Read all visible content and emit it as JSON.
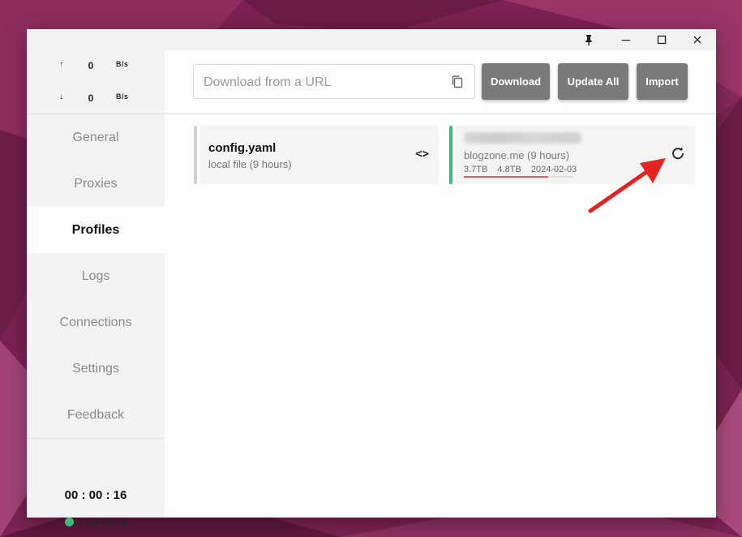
{
  "window": {
    "controls": {
      "pin_icon": "pin-icon",
      "minimize_icon": "minimize-icon",
      "maximize_icon": "maximize-icon",
      "close_icon": "close-icon"
    }
  },
  "traffic": {
    "upload": {
      "arrow": "↑",
      "value": "0",
      "unit": "B/s"
    },
    "download": {
      "arrow": "↓",
      "value": "0",
      "unit": "B/s"
    }
  },
  "sidebar": {
    "items": [
      {
        "label": "General",
        "active": false
      },
      {
        "label": "Proxies",
        "active": false
      },
      {
        "label": "Profiles",
        "active": true
      },
      {
        "label": "Logs",
        "active": false
      },
      {
        "label": "Connections",
        "active": false
      },
      {
        "label": "Settings",
        "active": false
      },
      {
        "label": "Feedback",
        "active": false
      }
    ],
    "timer": "00 : 00 : 16",
    "status": {
      "label": "Connected",
      "color": "#3dba7e"
    }
  },
  "toolbar": {
    "url_placeholder": "Download from a URL",
    "url_value": "",
    "copy_icon": "copy-icon",
    "download_label": "Download",
    "update_all_label": "Update All",
    "import_label": "Import"
  },
  "profiles": [
    {
      "name": "config.yaml",
      "subtitle": "local file (9 hours)",
      "bar_color": "#d0d0d0",
      "action_icon": "code-icon",
      "action_glyph": "<>"
    },
    {
      "subtitle": "blogzone.me (9 hours)",
      "bar_color": "#3dba7e",
      "used": "3.7TB",
      "total": "4.8TB",
      "expire": "2024-02-03",
      "usage_fraction": 0.77,
      "usage_color": "#e35d6a",
      "action_icon": "refresh-icon"
    }
  ],
  "annotation": {
    "arrow_color": "#e32222"
  }
}
